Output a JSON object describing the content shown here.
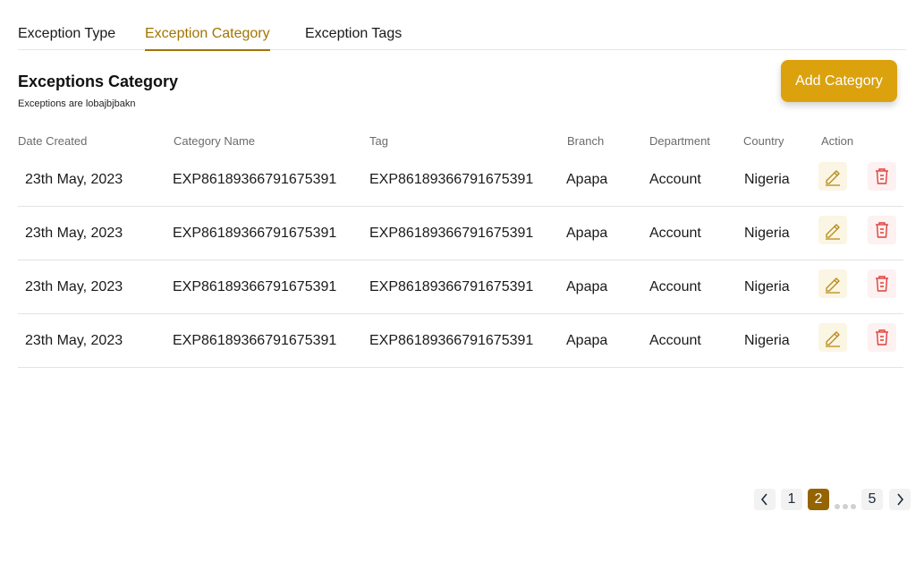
{
  "tabs": [
    {
      "label": "Exception Type"
    },
    {
      "label": "Exception Category"
    },
    {
      "label": "Exception Tags"
    }
  ],
  "section": {
    "title": "Exceptions Category",
    "subtitle": "Exceptions are lobajbjbakn",
    "add_button_label": "Add Category"
  },
  "table": {
    "headers": {
      "date": "Date Created",
      "name": "Category Name",
      "tag": "Tag",
      "branch": "Branch",
      "department": "Department",
      "country": "Country",
      "action": "Action"
    },
    "rows": [
      {
        "date": "23th May, 2023",
        "name": "EXP86189366791675391",
        "tag": "EXP86189366791675391",
        "branch": "Apapa",
        "department": "Account",
        "country": "Nigeria"
      },
      {
        "date": "23th May, 2023",
        "name": "EXP86189366791675391",
        "tag": "EXP86189366791675391",
        "branch": "Apapa",
        "department": "Account",
        "country": "Nigeria"
      },
      {
        "date": "23th May, 2023",
        "name": "EXP86189366791675391",
        "tag": "EXP86189366791675391",
        "branch": "Apapa",
        "department": "Account",
        "country": "Nigeria"
      },
      {
        "date": "23th May, 2023",
        "name": "EXP86189366791675391",
        "tag": "EXP86189366791675391",
        "branch": "Apapa",
        "department": "Account",
        "country": "Nigeria"
      }
    ]
  },
  "pagination": {
    "pages": [
      "1",
      "2",
      "5"
    ],
    "current": "2"
  },
  "icons": {
    "edit": "pencil-icon",
    "delete": "trash-icon",
    "prev": "chevron-left-icon",
    "next": "chevron-right-icon"
  },
  "colors": {
    "accent": "#a27400",
    "button": "#dba20d",
    "page_active": "#946400",
    "delete": "#e0403a"
  }
}
